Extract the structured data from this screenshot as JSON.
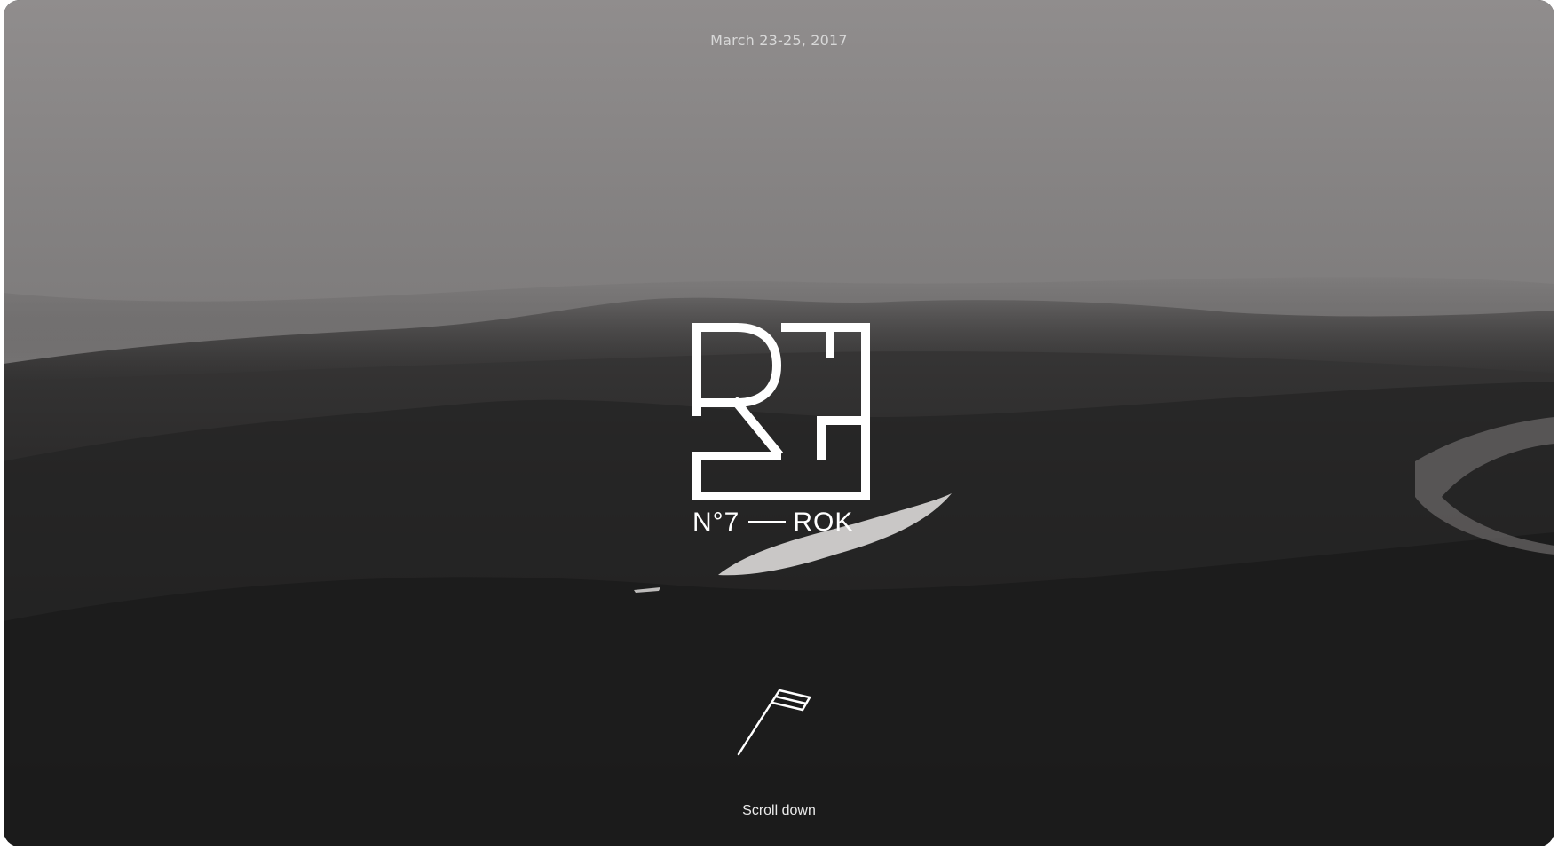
{
  "hero": {
    "date": "March 23-25, 2017",
    "logo_text": "RF",
    "edition_number": "N°7",
    "edition_location": "ROK",
    "scroll_label": "Scroll down"
  },
  "icons": {
    "logo": "rf-monogram-icon",
    "scroll": "flag-icon",
    "separator": "dash-icon"
  },
  "colors": {
    "fog": "#8a8888",
    "ground": "#1e1e1e",
    "text": "#ffffff"
  }
}
